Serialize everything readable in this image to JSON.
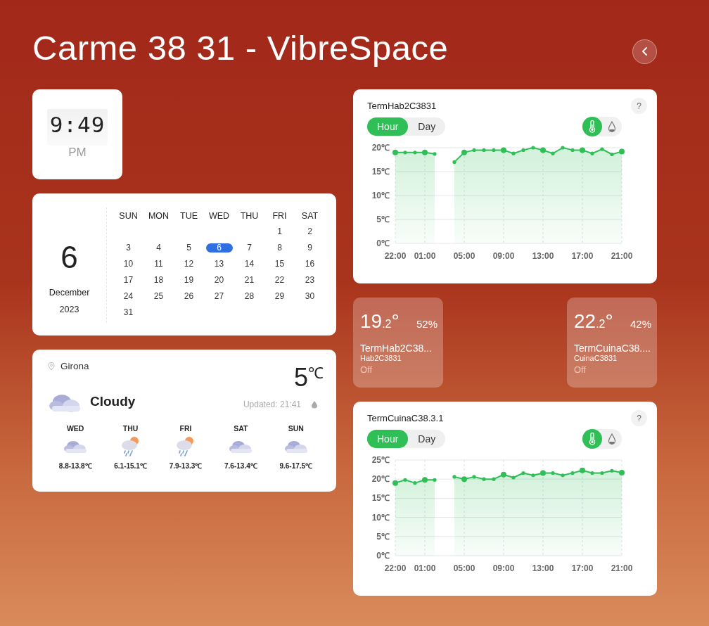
{
  "title": "Carme 38 31 - VibreSpace",
  "clock": {
    "time": "9:49",
    "period": "PM"
  },
  "calendar": {
    "day": "6",
    "month": "December",
    "year": "2023",
    "weekdays": [
      "SUN",
      "MON",
      "TUE",
      "WED",
      "THU",
      "FRI",
      "SAT"
    ],
    "weeks": [
      [
        {
          "label": "1",
          "selected": false
        },
        {
          "label": "2",
          "selected": false
        }
      ],
      [
        {
          "label": "3",
          "selected": false
        },
        {
          "label": "4",
          "selected": false
        },
        {
          "label": "5",
          "selected": false
        },
        {
          "label": "6",
          "selected": true
        },
        {
          "label": "7",
          "selected": false
        },
        {
          "label": "8",
          "selected": false
        },
        {
          "label": "9",
          "selected": false
        }
      ],
      [
        {
          "label": "10",
          "selected": false
        },
        {
          "label": "11",
          "selected": false
        },
        {
          "label": "12",
          "selected": false
        },
        {
          "label": "13",
          "selected": false
        },
        {
          "label": "14",
          "selected": false
        },
        {
          "label": "15",
          "selected": false
        },
        {
          "label": "16",
          "selected": false
        }
      ],
      [
        {
          "label": "17",
          "selected": false
        },
        {
          "label": "18",
          "selected": false
        },
        {
          "label": "19",
          "selected": false
        },
        {
          "label": "20",
          "selected": false
        },
        {
          "label": "21",
          "selected": false
        },
        {
          "label": "22",
          "selected": false
        },
        {
          "label": "23",
          "selected": false
        }
      ],
      [
        {
          "label": "24",
          "selected": false
        },
        {
          "label": "25",
          "selected": false
        },
        {
          "label": "26",
          "selected": false
        },
        {
          "label": "27",
          "selected": false
        },
        {
          "label": "28",
          "selected": false
        },
        {
          "label": "29",
          "selected": false
        },
        {
          "label": "30",
          "selected": false
        }
      ],
      [
        {
          "label": "31",
          "selected": false
        }
      ]
    ]
  },
  "weather": {
    "location": "Girona",
    "temperature": "5",
    "unit": "℃",
    "condition": "Cloudy",
    "kind": "cloudy",
    "updated": "Updated: 21:41",
    "forecast": [
      {
        "day": "WED",
        "kind": "cloudy",
        "range": "8.8-13.8℃"
      },
      {
        "day": "THU",
        "kind": "rain-sun",
        "range": "6.1-15.1℃"
      },
      {
        "day": "FRI",
        "kind": "rain-sun",
        "range": "7.9-13.3℃"
      },
      {
        "day": "SAT",
        "kind": "cloudy",
        "range": "7.6-13.4℃"
      },
      {
        "day": "SUN",
        "kind": "cloudy",
        "range": "9.6-17.5℃"
      }
    ]
  },
  "right_column": [
    {
      "kind": "chart",
      "title": "TermHab2C3831",
      "help": "?",
      "ranges": [
        {
          "label": "Hour",
          "selected": true
        },
        {
          "label": "Day",
          "selected": false
        }
      ],
      "metrics": [
        {
          "kind": "temperature",
          "selected": true
        },
        {
          "kind": "humidity",
          "selected": false
        }
      ],
      "chart_data": {
        "type": "area",
        "grid": true,
        "categories": [
          "22:00",
          null,
          null,
          "01:00",
          null,
          null,
          null,
          "05:00",
          null,
          null,
          null,
          "09:00",
          null,
          null,
          null,
          "13:00",
          null,
          null,
          null,
          "17:00",
          null,
          null,
          null,
          "21:00"
        ],
        "series": [
          {
            "color": "#2fbf56",
            "values": [
              19,
              19,
              19,
              19,
              18.7,
              null,
              17,
              19,
              19.5,
              19.5,
              19.5,
              19.5,
              18.8,
              19.5,
              20,
              19.5,
              18.8,
              20,
              19.5,
              19.5,
              18.8,
              19.7,
              18.6,
              19.2
            ]
          }
        ],
        "ylim": [
          0,
          20
        ],
        "yticks": [
          {
            "value": 0,
            "label": "0℃"
          },
          {
            "value": 5,
            "label": "5℃"
          },
          {
            "value": 10,
            "label": "10℃"
          },
          {
            "value": 15,
            "label": "15℃"
          },
          {
            "value": 20,
            "label": "20℃"
          }
        ]
      }
    },
    {
      "kind": "thermostats",
      "items": [
        {
          "temperature": "19",
          "decimal": ".2",
          "degree": "°",
          "humidity": "52%",
          "name": "TermHab2C38...",
          "room": "Hab2C3831",
          "status": "Off"
        },
        {
          "temperature": "22",
          "decimal": ".2",
          "degree": "°",
          "humidity": "42%",
          "name": "TermCuinaC38....",
          "room": "CuinaC3831",
          "status": "Off"
        }
      ]
    },
    {
      "kind": "chart",
      "title": "TermCuinaC38.3.1",
      "help": "?",
      "ranges": [
        {
          "label": "Hour",
          "selected": true
        },
        {
          "label": "Day",
          "selected": false
        }
      ],
      "metrics": [
        {
          "kind": "temperature",
          "selected": true
        },
        {
          "kind": "humidity",
          "selected": false
        }
      ],
      "chart_data": {
        "type": "area",
        "grid": true,
        "categories": [
          "22:00",
          null,
          null,
          "01:00",
          null,
          null,
          null,
          "05:00",
          null,
          null,
          null,
          "09:00",
          null,
          null,
          null,
          "13:00",
          null,
          null,
          null,
          "17:00",
          null,
          null,
          null,
          "21:00"
        ],
        "series": [
          {
            "color": "#2fbf56",
            "values": [
              19,
              19.8,
              19,
              19.8,
              19.8,
              null,
              20.6,
              20,
              20.6,
              20,
              20,
              21.2,
              20.4,
              21.6,
              21,
              21.6,
              21.6,
              21,
              21.6,
              22.3,
              21.6,
              21.6,
              22.2,
              21.7
            ]
          }
        ],
        "ylim": [
          0,
          25
        ],
        "yticks": [
          {
            "value": 0,
            "label": "0℃"
          },
          {
            "value": 5,
            "label": "5℃"
          },
          {
            "value": 10,
            "label": "10℃"
          },
          {
            "value": 15,
            "label": "15℃"
          },
          {
            "value": 20,
            "label": "20℃"
          },
          {
            "value": 25,
            "label": "25℃"
          }
        ]
      }
    }
  ]
}
